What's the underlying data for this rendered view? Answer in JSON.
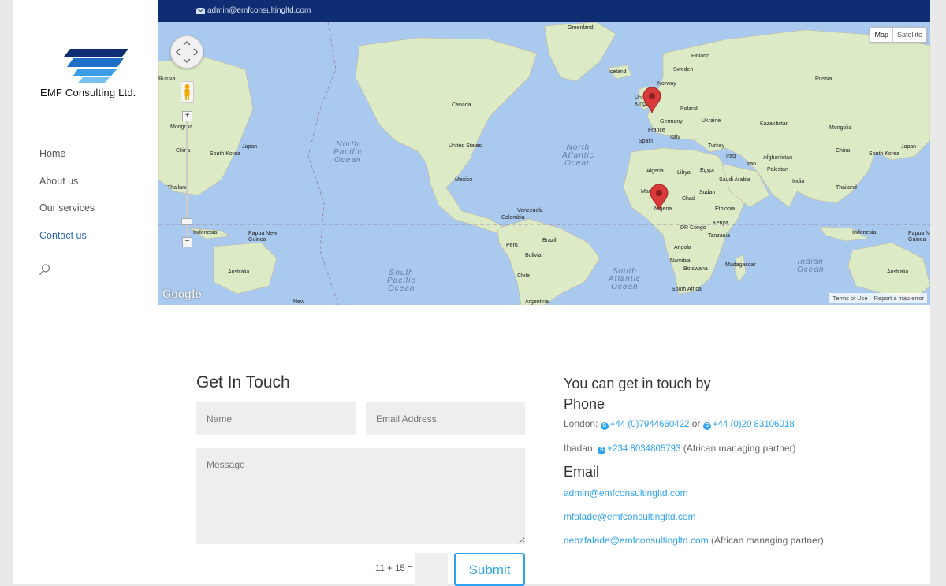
{
  "topbar": {
    "email": "admin@emfconsultingltd.com"
  },
  "brand": {
    "name": "EMF Consulting Ltd.",
    "colors": {
      "top": "#0f2d73",
      "link": "#2ea3f2",
      "active_nav": "#2d6ab1"
    }
  },
  "nav": {
    "items": [
      "Home",
      "About us",
      "Our services",
      "Contact us"
    ],
    "active": "Contact us"
  },
  "map": {
    "type_buttons": {
      "map": "Map",
      "satellite": "Satellite"
    },
    "google": "Google",
    "terms": "Terms of Use",
    "report": "Report a map error",
    "ocean_labels": {
      "north_pacific": "North\nPacific\nOcean",
      "north_atlantic": "North\nAtlantic\nOcean",
      "south_pacific": "South\nPacific\nOcean",
      "south_atlantic": "South\nAtlantic\nOcean",
      "indian": "Indian\nOcean"
    },
    "labels": {
      "greenland": "Greenland",
      "iceland": "Iceland",
      "finland": "Finland",
      "sweden": "Sweden",
      "norway": "Norway",
      "russia_e": "Russia",
      "russia_w": "Russia",
      "poland": "Poland",
      "germany": "Germany",
      "ukraine": "Ukraine",
      "france": "France",
      "spain": "Spain",
      "italy": "Italy",
      "turkey": "Turkey",
      "kazakhstan": "Kazakhstan",
      "mongolia_e": "Mongolia",
      "mongolia_w": "Mongolia",
      "china_e": "China",
      "china_w": "China",
      "japan_e": "Japan",
      "japan_w": "Japan",
      "south_korea_e": "South Korea",
      "south_korea_w": "South Korea",
      "canada": "Canada",
      "united_states": "United States",
      "mexico": "Mexico",
      "venezuela": "Venezuela",
      "colombia": "Colombia",
      "peru": "Peru",
      "brazil": "Brazil",
      "bolivia": "Bolivia",
      "chile": "Chile",
      "argentina": "Argentina",
      "algeria": "Algeria",
      "libya": "Libya",
      "egypt": "Egypt",
      "chad": "Chad",
      "sudan": "Sudan",
      "ethiopia": "Ethiopia",
      "kenya": "Kenya",
      "dr_congo": "DR Congo",
      "tanzania": "Tanzania",
      "angola": "Angola",
      "namibia": "Namibia",
      "botswana": "Botswana",
      "south_africa": "South Africa",
      "madagascar": "Madagascar",
      "iraq": "Iraq",
      "iran": "Iran",
      "saudi_arabia": "Saudi Arabia",
      "afghanistan": "Afghanistan",
      "pakistan": "Pakistan",
      "india": "India",
      "thailand_e": "Thailand",
      "thailand_w": "Thailand",
      "indonesia_e": "Indonesia",
      "indonesia_w": "Indonesia",
      "png_e": "Papua New\nGuinea",
      "png_w": "Papua New\nGuinea",
      "australia_e": "Australia",
      "australia_w": "Australia",
      "new": "New",
      "united_kingdom": "United\nKingdom",
      "nigeria": "Nigeria",
      "mauritania": "Mauritania"
    }
  },
  "form": {
    "title": "Get In Touch",
    "name_placeholder": "Name",
    "email_placeholder": "Email Address",
    "message_placeholder": "Message",
    "captcha": "11 + 15 =",
    "submit": "Submit"
  },
  "contact": {
    "heading_line1": "You can get in touch by",
    "heading_line2": "Phone",
    "london_label": "London:",
    "london_phone1": "+44 (0)7944660422",
    "or": "or",
    "london_phone2": "+44 (0)20 83106018",
    "ibadan_label": "Ibadan:",
    "ibadan_phone": "+234 8034805793",
    "ibadan_note": "(African managing partner)",
    "email_heading": "Email",
    "email1": "admin@emfconsultingltd.com",
    "email2": "mfalade@emfconsultingltd.com",
    "email3": "debzfalade@emfconsultingltd.com",
    "email3_note": "(African managing partner)"
  }
}
